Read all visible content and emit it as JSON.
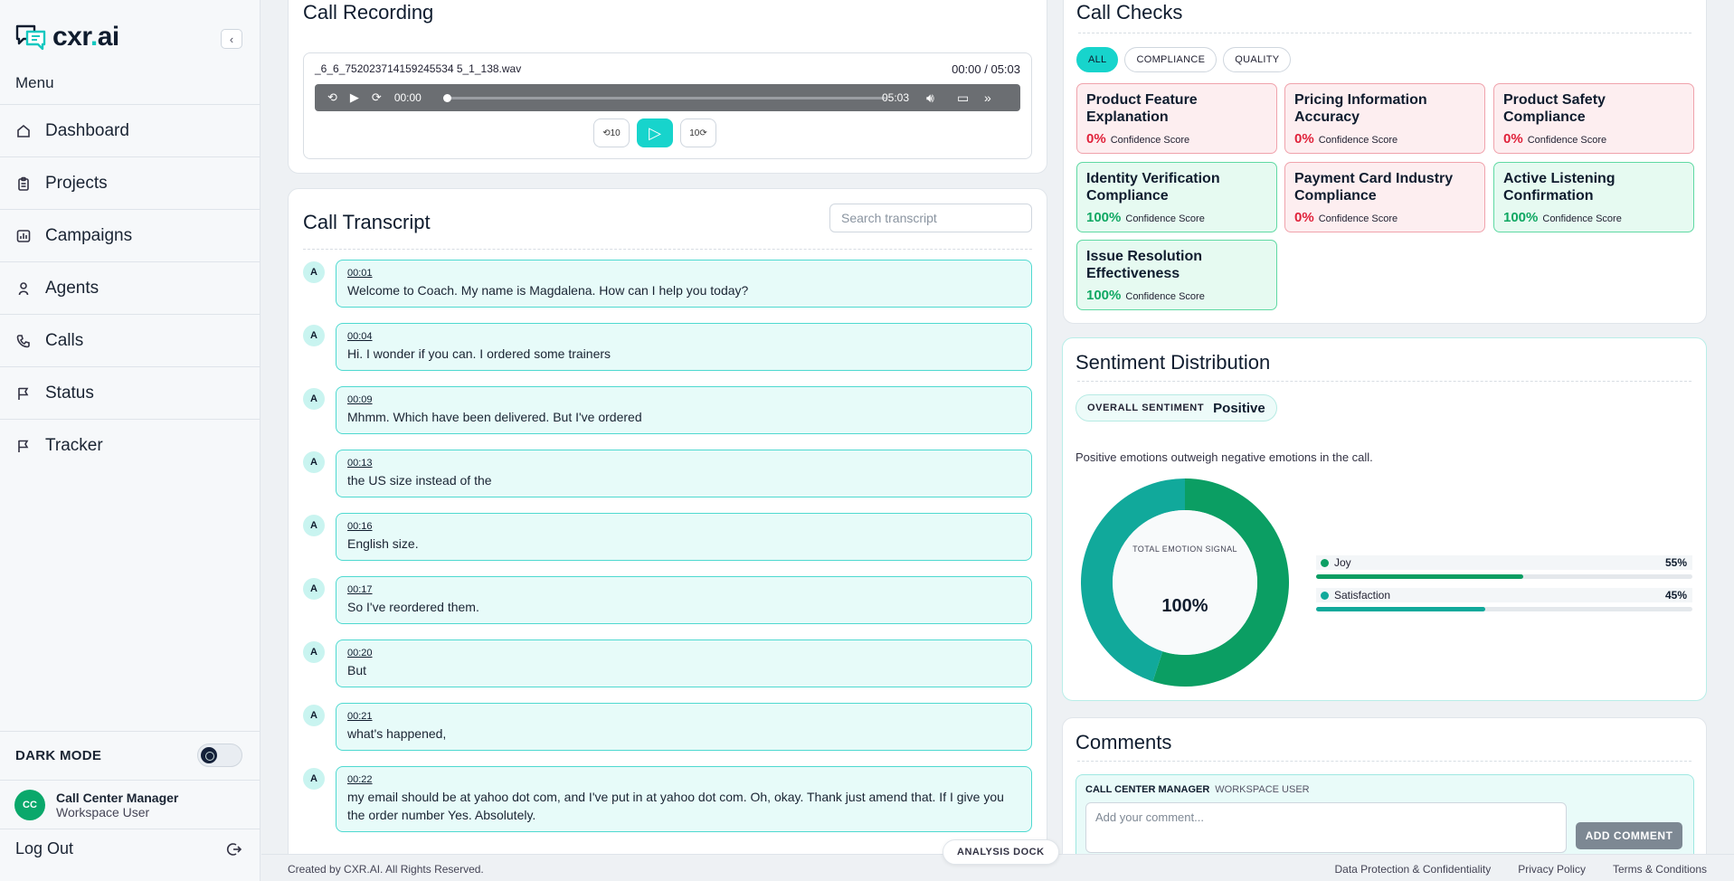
{
  "brand": {
    "logo_main": "cxr",
    "logo_dot": ".",
    "logo_tail": "ai"
  },
  "sidebar": {
    "menu_title": "Menu",
    "items": [
      {
        "label": "Dashboard",
        "icon": "home-icon"
      },
      {
        "label": "Projects",
        "icon": "clipboard-icon"
      },
      {
        "label": "Campaigns",
        "icon": "chart-icon"
      },
      {
        "label": "Agents",
        "icon": "user-icon"
      },
      {
        "label": "Calls",
        "icon": "phone-icon"
      },
      {
        "label": "Status",
        "icon": "flag-icon"
      },
      {
        "label": "Tracker",
        "icon": "flag-icon"
      }
    ],
    "dark_mode_label": "DARK MODE",
    "user": {
      "initials": "CC",
      "name": "Call Center Manager",
      "role": "Workspace User"
    },
    "logout_label": "Log Out"
  },
  "recording": {
    "title": "Call Recording",
    "file_name": "_6_6_752023714159245534 5_1_138.wav",
    "time_display": "00:00 / 05:03",
    "current_time": "00:00",
    "duration": "05:03",
    "progress": 0
  },
  "transcript": {
    "title": "Call Transcript",
    "search_placeholder": "Search transcript",
    "messages": [
      {
        "speaker": "A",
        "time": "00:01",
        "text": "Welcome to Coach. My name is Magdalena. How can I help you today?"
      },
      {
        "speaker": "A",
        "time": "00:04",
        "text": "Hi. I wonder if you can. I ordered some trainers"
      },
      {
        "speaker": "A",
        "time": "00:09",
        "text": "Mhmm. Which have been delivered. But I've ordered"
      },
      {
        "speaker": "A",
        "time": "00:13",
        "text": "the US size instead of the"
      },
      {
        "speaker": "A",
        "time": "00:16",
        "text": "English size."
      },
      {
        "speaker": "A",
        "time": "00:17",
        "text": "So I've reordered them."
      },
      {
        "speaker": "A",
        "time": "00:20",
        "text": "But"
      },
      {
        "speaker": "A",
        "time": "00:21",
        "text": "what's happened,"
      },
      {
        "speaker": "A",
        "time": "00:22",
        "text": "my email should be at yahoo dot com, and I've put in at yahoo dot com. Oh, okay. Thank just amend that. If I give you the order number Yes. Absolutely."
      }
    ]
  },
  "checks": {
    "title": "Call Checks",
    "filters": [
      "ALL",
      "COMPLIANCE",
      "QUALITY"
    ],
    "score_label": "Confidence Score",
    "items": [
      {
        "title": "Product Feature Explanation",
        "score": "0%",
        "status": "fail"
      },
      {
        "title": "Pricing Information Accuracy",
        "score": "0%",
        "status": "fail"
      },
      {
        "title": "Product Safety Compliance",
        "score": "0%",
        "status": "fail"
      },
      {
        "title": "Identity Verification Compliance",
        "score": "100%",
        "status": "pass"
      },
      {
        "title": "Payment Card Industry Compliance",
        "score": "0%",
        "status": "fail"
      },
      {
        "title": "Active Listening Confirmation",
        "score": "100%",
        "status": "pass"
      },
      {
        "title": "Issue Resolution Effectiveness",
        "score": "100%",
        "status": "pass"
      }
    ]
  },
  "sentiment": {
    "title": "Sentiment Distribution",
    "overall_label": "OVERALL SENTIMENT",
    "overall_value": "Positive",
    "description": "Positive emotions outweigh negative emotions in the call.",
    "center_label": "TOTAL EMOTION SIGNAL",
    "center_value": "100%",
    "emotions": [
      {
        "name": "Joy",
        "pct_text": "55%",
        "value": 55,
        "color": "#0b9e63"
      },
      {
        "name": "Satisfaction",
        "pct_text": "45%",
        "value": 45,
        "color": "#11a99b"
      }
    ]
  },
  "comments": {
    "title": "Comments",
    "user": "CALL CENTER MANAGER",
    "role": "WORKSPACE USER",
    "placeholder": "Add your comment...",
    "button": "ADD COMMENT"
  },
  "footer": {
    "copyright": "Created by CXR.AI. All Rights Reserved.",
    "links": [
      "Data Protection & Confidentiality",
      "Privacy Policy",
      "Terms & Conditions"
    ],
    "dock": "ANALYSIS DOCK"
  },
  "colors": {
    "accent": "#17d4cc",
    "pass": "#10a863",
    "fail": "#e0213a"
  }
}
